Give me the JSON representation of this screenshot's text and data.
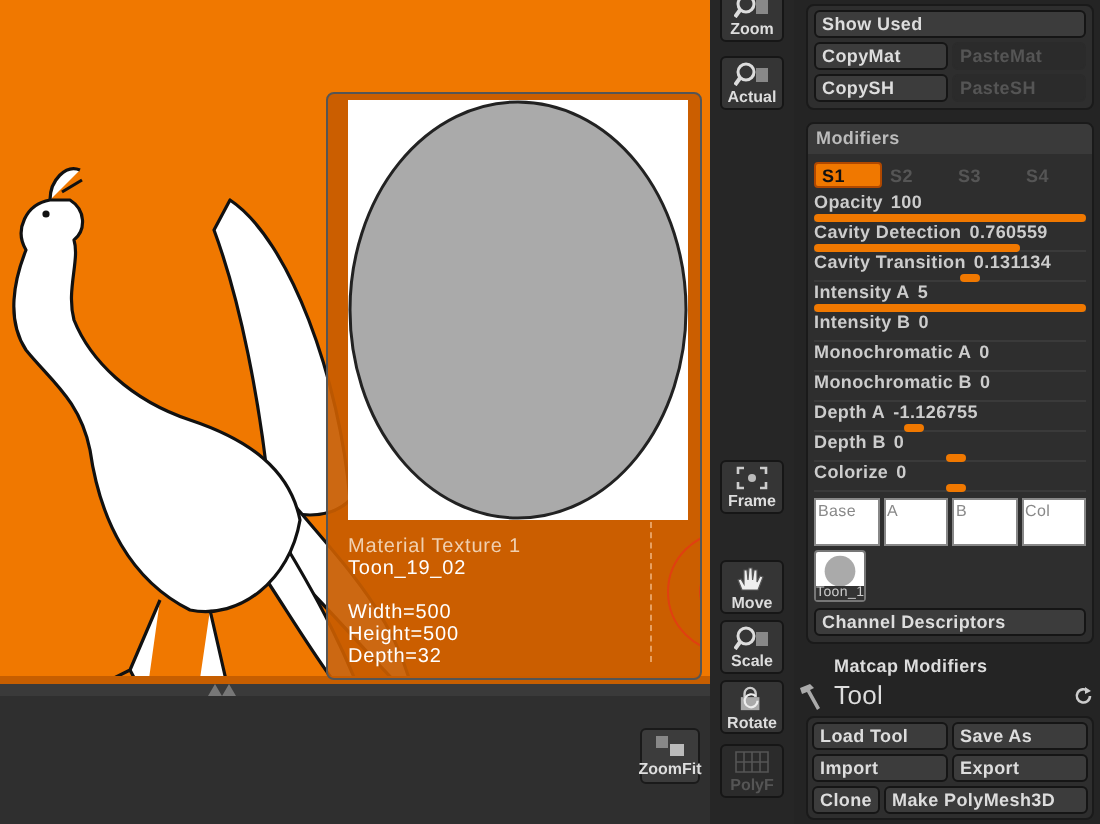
{
  "popup": {
    "title": "Material Texture 1",
    "name": "Toon_19_02",
    "details": [
      "Width=500",
      "Height=500",
      "Depth=32"
    ]
  },
  "toolbar": {
    "buttons": [
      {
        "label": "Zoom",
        "kind": "magnifier",
        "disabled": false
      },
      {
        "label": "Actual",
        "kind": "magnifier",
        "disabled": false
      },
      {
        "label": "Frame",
        "kind": "frame",
        "disabled": false
      },
      {
        "label": "Move",
        "kind": "hand",
        "disabled": false
      },
      {
        "label": "Scale",
        "kind": "magnifier",
        "disabled": false
      },
      {
        "label": "Rotate",
        "kind": "rotate",
        "disabled": false
      },
      {
        "label": "PolyF",
        "kind": "grid",
        "disabled": true
      }
    ]
  },
  "bottom_bar": {
    "button": {
      "label": "ZoomFit"
    }
  },
  "material": {
    "rows": [
      [
        {
          "label": "Show Used",
          "disabled": false
        }
      ],
      [
        {
          "label": "CopyMat",
          "disabled": false
        },
        {
          "label": "PasteMat",
          "disabled": true
        }
      ],
      [
        {
          "label": "CopySH",
          "disabled": false
        },
        {
          "label": "PasteSH",
          "disabled": true
        }
      ]
    ]
  },
  "modifiers": {
    "title": "Modifiers",
    "tabs": [
      {
        "label": "S1",
        "selected": true
      },
      {
        "label": "S2",
        "selected": false
      },
      {
        "label": "S3",
        "selected": false
      },
      {
        "label": "S4",
        "selected": false
      }
    ],
    "sliders": [
      {
        "label": "Opacity",
        "value": "100",
        "kind": "fill",
        "level": 1
      },
      {
        "label": "Cavity Detection",
        "value": "0.760559",
        "kind": "fill",
        "level": 0.76
      },
      {
        "label": "Cavity Transition",
        "value": "0.131134",
        "kind": "thumb",
        "level": 0.57
      },
      {
        "label": "Intensity A",
        "value": "5",
        "kind": "fill",
        "level": 1
      },
      {
        "label": "Intensity B",
        "value": "0",
        "kind": "plain"
      },
      {
        "label": "Monochromatic A",
        "value": "0",
        "kind": "plain"
      },
      {
        "label": "Monochromatic B",
        "value": "0",
        "kind": "plain"
      },
      {
        "label": "Depth A",
        "value": "-1.126755",
        "kind": "thumb",
        "level": 0.37
      },
      {
        "label": "Depth B",
        "value": "0",
        "kind": "thumb",
        "level": 0.52
      },
      {
        "label": "Colorize",
        "value": "0",
        "kind": "thumb",
        "level": 0.52
      }
    ],
    "channels": [
      "Base",
      "A",
      "B",
      "Col"
    ],
    "thumbnail": {
      "label": "Toon_1"
    },
    "descriptors_button": "Channel Descriptors"
  },
  "matcap_modifiers": "Matcap Modifiers",
  "tool": {
    "title": "Tool",
    "rows": [
      [
        {
          "label": "Load Tool"
        },
        {
          "label": "Save As"
        }
      ],
      [
        {
          "label": "Import"
        },
        {
          "label": "Export"
        }
      ],
      [
        {
          "label": "Clone"
        },
        {
          "label": "Make PolyMesh3D"
        }
      ]
    ]
  }
}
